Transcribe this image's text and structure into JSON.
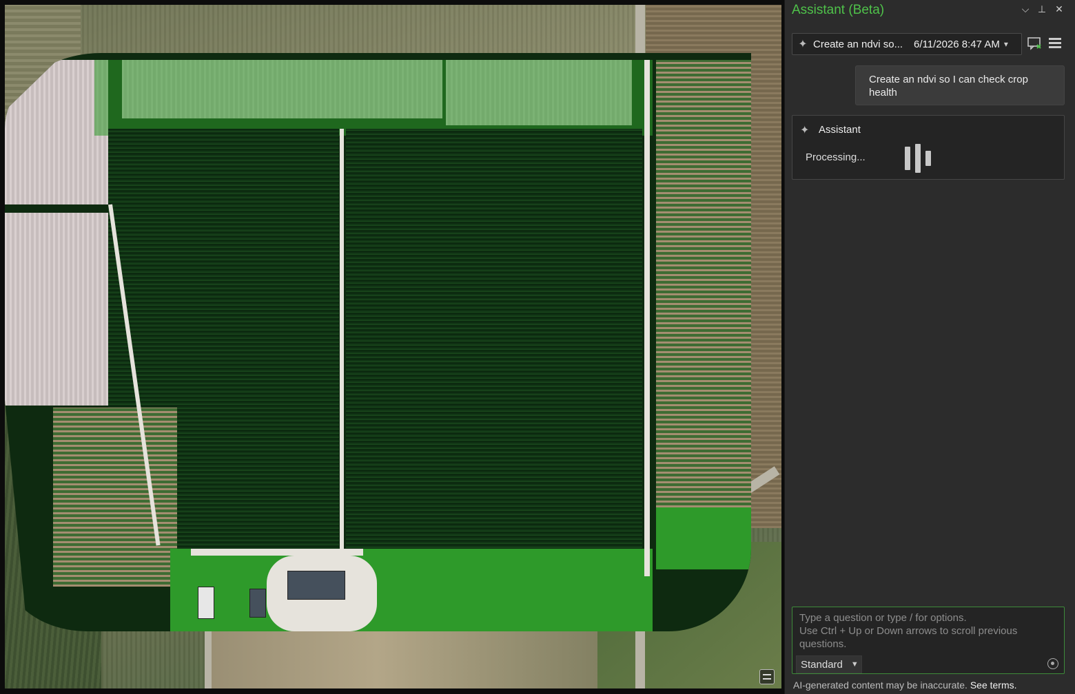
{
  "pane": {
    "title": "Assistant (Beta)",
    "window_controls": {
      "dropdown": "⌵",
      "pin": "⊥",
      "close": "✕"
    }
  },
  "conversation": {
    "title": "Create an ndvi so...",
    "timestamp": "6/11/2026 8:47 AM"
  },
  "messages": {
    "user": "Create an ndvi so I can check crop health",
    "assistant_name": "Assistant",
    "status": "Processing..."
  },
  "input": {
    "placeholder": "Type a question or type / for options.\nUse Ctrl + Up or Down arrows to scroll previous questions.",
    "mode": "Standard"
  },
  "footer": {
    "disclaimer": "AI-generated content may be inaccurate.",
    "terms_link": "See terms."
  },
  "colors": {
    "accent_green": "#4fc24a",
    "pane_bg": "#2c2c2c",
    "ndvi_vegetation": "#0e2a10"
  },
  "icons": [
    "sparkle-icon",
    "new-chat-icon",
    "menu-icon",
    "chevron-down-icon",
    "send-icon",
    "pin-icon",
    "close-icon",
    "map-tool-icon"
  ]
}
